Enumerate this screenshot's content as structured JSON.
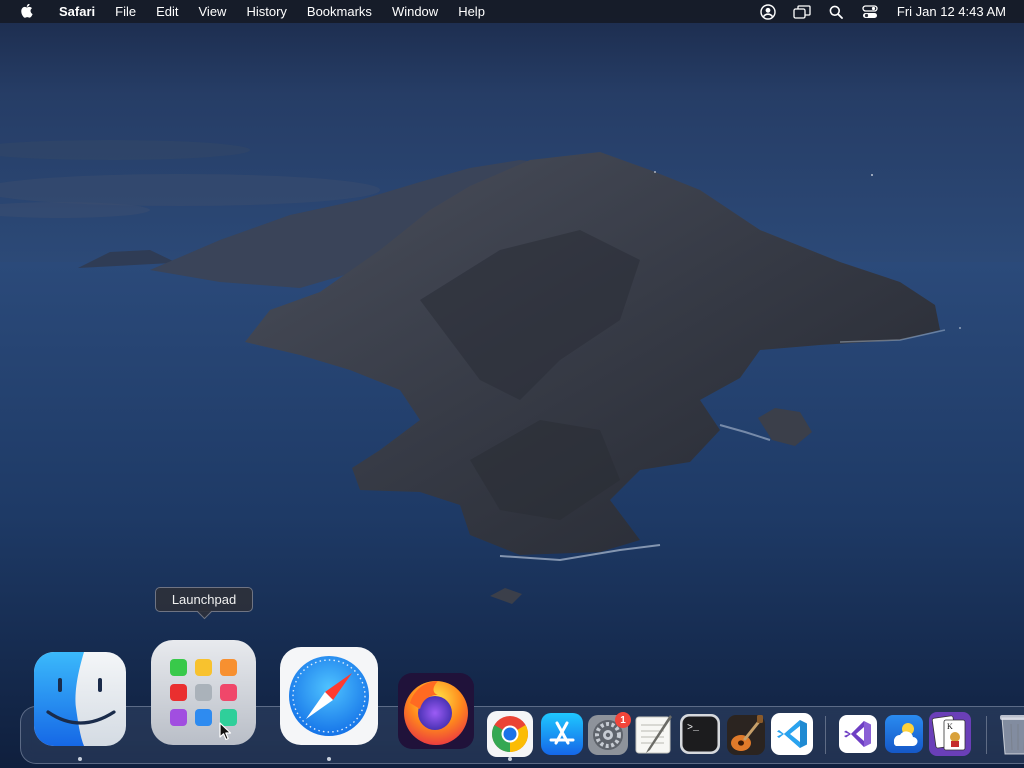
{
  "menubar": {
    "apple_icon": "apple-logo-icon",
    "app_name": "Safari",
    "menus": [
      "File",
      "Edit",
      "View",
      "History",
      "Bookmarks",
      "Window",
      "Help"
    ],
    "status_icons": [
      "user-account-icon",
      "screen-mirroring-icon",
      "spotlight-search-icon",
      "control-center-icon"
    ],
    "clock": "Fri Jan 12  4:43 AM"
  },
  "tooltip": {
    "text": "Launchpad"
  },
  "dock": {
    "items": [
      {
        "name": "Finder",
        "icon": "finder-icon",
        "running": true
      },
      {
        "name": "Launchpad",
        "icon": "launchpad-icon",
        "running": false,
        "hovered": true
      },
      {
        "name": "Safari",
        "icon": "safari-icon",
        "running": true
      },
      {
        "name": "Firefox",
        "icon": "firefox-icon",
        "running": false
      },
      {
        "name": "Google Chrome",
        "icon": "chrome-icon",
        "running": true
      },
      {
        "name": "App Store",
        "icon": "app-store-icon",
        "running": false
      },
      {
        "name": "System Preferences",
        "icon": "system-preferences-icon",
        "running": false,
        "badge": "1"
      },
      {
        "name": "TextEdit",
        "icon": "textedit-icon",
        "running": false
      },
      {
        "name": "Terminal",
        "icon": "terminal-icon",
        "running": false,
        "glyph": ">_"
      },
      {
        "name": "GarageBand",
        "icon": "garageband-icon",
        "running": false
      },
      {
        "name": "Visual Studio Code",
        "icon": "vscode-icon",
        "running": false
      },
      {
        "name": "Visual Studio",
        "icon": "visual-studio-icon",
        "running": false
      },
      {
        "name": "Weather",
        "icon": "weather-icon",
        "running": false
      },
      {
        "name": "Solitaire",
        "icon": "solitaire-icon",
        "running": false
      },
      {
        "name": "Trash",
        "icon": "trash-icon",
        "running": false
      }
    ]
  },
  "colors": {
    "menubar_bg": "#161a24",
    "badge": "#f2453a",
    "safari_blue": "#1d8ff0",
    "vscode_blue": "#1f8ad2",
    "visual_studio_purple": "#8a5fd6"
  }
}
